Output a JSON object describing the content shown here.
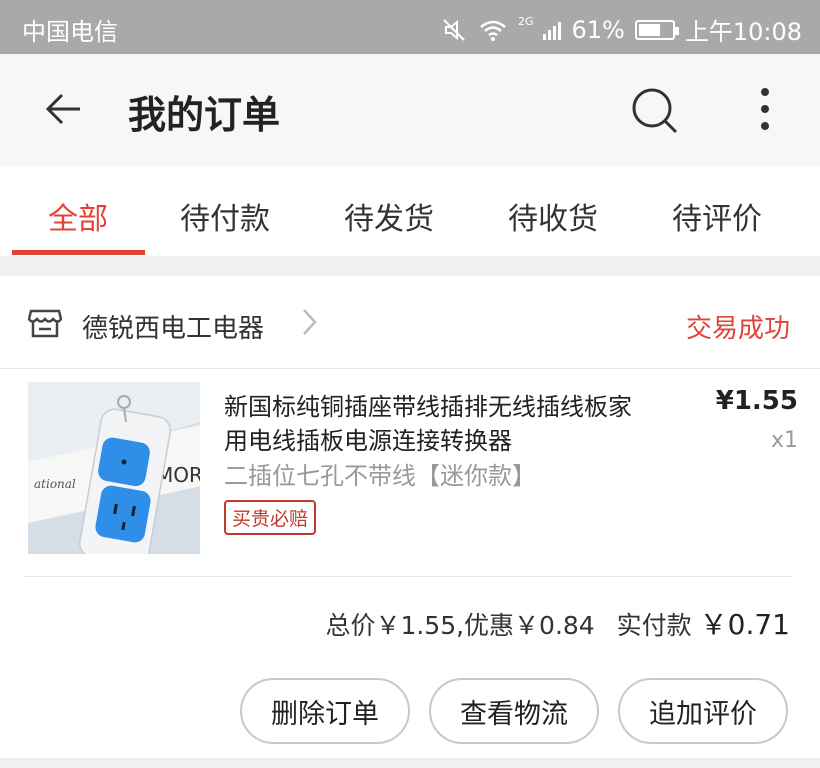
{
  "status_bar": {
    "carrier": "中国电信",
    "network": "2G",
    "battery": "61%",
    "time": "上午10:08"
  },
  "header": {
    "title": "我的订单"
  },
  "tabs": [
    {
      "label": "全部",
      "active": true
    },
    {
      "label": "待付款",
      "active": false
    },
    {
      "label": "待发货",
      "active": false
    },
    {
      "label": "待收货",
      "active": false
    },
    {
      "label": "待评价",
      "active": false
    }
  ],
  "order": {
    "store_name": "德锐西电工电器",
    "status": "交易成功",
    "product": {
      "title": "新国标纯铜插座带线插排无线插线板家用电线插板电源连接转换器",
      "spec": "二插位七孔不带线【迷你款】",
      "badge": "买贵必赔",
      "price": "¥1.55",
      "quantity": "x1"
    },
    "summary": {
      "total": "总价￥1.55,优惠￥0.84",
      "paid_label": "实付款",
      "paid_value": "￥0.71"
    },
    "actions": {
      "delete": "删除订单",
      "logistics": "查看物流",
      "review": "追加评价"
    }
  },
  "colors": {
    "accent": "#e14338",
    "status_bar": "#a9a9a9"
  },
  "icons": [
    "back-arrow-icon",
    "search-icon",
    "more-vertical-icon",
    "store-icon",
    "chevron-right-icon",
    "mute-icon",
    "wifi-icon",
    "signal-icon",
    "battery-icon"
  ]
}
